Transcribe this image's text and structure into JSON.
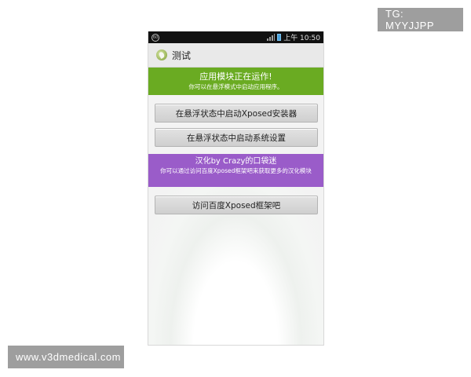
{
  "watermarks": {
    "top_right": "TG: MYYJJPP",
    "bottom_left": "www.v3dmedical.com"
  },
  "statusbar": {
    "left_icon": "notification-icon",
    "signal_icon": "signal-icon",
    "battery_icon": "battery-icon",
    "time": "上午 10:50"
  },
  "titlebar": {
    "icon": "app-leaf-icon",
    "title": "测试"
  },
  "status_banner": {
    "title": "应用模块正在运作!",
    "subtitle": "你可以在悬浮模式中启动应用程序。",
    "color": "#6aab22"
  },
  "buttons": {
    "installer": "在悬浮状态中启动Xposed安装器",
    "settings": "在悬浮状态中启动系统设置",
    "visit": "访问百度Xposed框架吧"
  },
  "credit_banner": {
    "title": "汉化by Crazy的口袋迷",
    "subtitle": "你可以通过访问百度Xposed框架吧来获取更多的汉化模块",
    "color": "#9a5cc9"
  }
}
